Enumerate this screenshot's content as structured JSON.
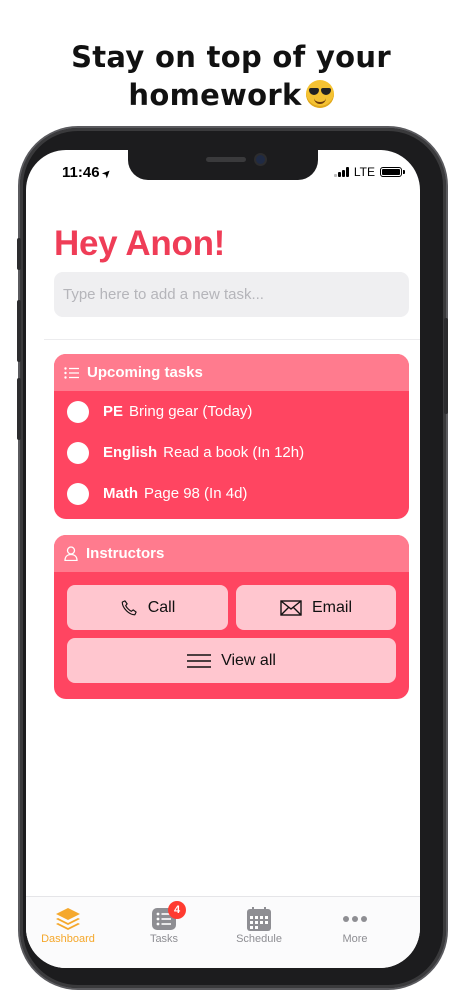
{
  "headline": {
    "line1": "Stay on top of your",
    "line2": "homework"
  },
  "status_bar": {
    "time": "11:46",
    "network": "LTE"
  },
  "greeting": "Hey Anon!",
  "task_input": {
    "placeholder": "Type here to add a new task...",
    "value": ""
  },
  "upcoming": {
    "title": "Upcoming tasks",
    "tasks": [
      {
        "subject": "PE",
        "description": "Bring gear (Today)"
      },
      {
        "subject": "English",
        "description": "Read a book (In 12h)"
      },
      {
        "subject": "Math",
        "description": "Page 98 (In 4d)"
      }
    ]
  },
  "instructors": {
    "title": "Instructors",
    "call_label": "Call",
    "email_label": "Email",
    "view_all_label": "View all"
  },
  "tabbar": {
    "items": [
      {
        "label": "Dashboard",
        "icon": "layers-icon",
        "active": true
      },
      {
        "label": "Tasks",
        "icon": "list-icon",
        "badge": "4"
      },
      {
        "label": "Schedule",
        "icon": "calendar-icon"
      },
      {
        "label": "More",
        "icon": "more-icon"
      }
    ]
  },
  "colors": {
    "accent": "#ef3d57",
    "card": "#ff4561",
    "card_header": "#ff7b8e",
    "button": "#ffc6cf",
    "tab_active": "#f5a82c"
  }
}
